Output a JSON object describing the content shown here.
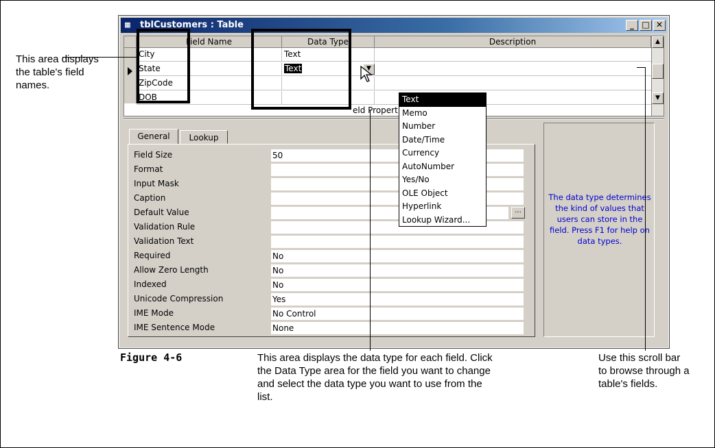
{
  "window": {
    "title": "tblCustomers : Table",
    "buttons": {
      "minimize": "_",
      "maximize": "□",
      "close": "✕"
    }
  },
  "grid": {
    "headers": [
      "Field Name",
      "Data Type",
      "Description"
    ],
    "rows": [
      {
        "field": "City",
        "type": "Text"
      },
      {
        "field": "State",
        "type": "Text"
      },
      {
        "field": "ZipCode",
        "type": ""
      },
      {
        "field": "DOB",
        "type": ""
      }
    ],
    "field_properties_label": "eld Properties"
  },
  "dropdown_items": [
    "Text",
    "Memo",
    "Number",
    "Date/Time",
    "Currency",
    "AutoNumber",
    "Yes/No",
    "OLE Object",
    "Hyperlink",
    "Lookup Wizard..."
  ],
  "tabs": [
    "General",
    "Lookup"
  ],
  "properties": [
    {
      "label": "Field Size",
      "value": "50"
    },
    {
      "label": "Format",
      "value": ""
    },
    {
      "label": "Input Mask",
      "value": ""
    },
    {
      "label": "Caption",
      "value": ""
    },
    {
      "label": "Default Value",
      "value": ""
    },
    {
      "label": "Validation Rule",
      "value": ""
    },
    {
      "label": "Validation Text",
      "value": ""
    },
    {
      "label": "Required",
      "value": "No"
    },
    {
      "label": "Allow Zero Length",
      "value": "No"
    },
    {
      "label": "Indexed",
      "value": "No"
    },
    {
      "label": "Unicode Compression",
      "value": "Yes"
    },
    {
      "label": "IME Mode",
      "value": "No Control"
    },
    {
      "label": "IME Sentence Mode",
      "value": "None"
    }
  ],
  "help_text": "The data type determines the kind of values that users can store in the field.  Press F1 for help on data types.",
  "annotations": {
    "left": "This area displays the table's field names.",
    "figure": "Figure 4-6",
    "bottom": "This area displays the data type for each field. Click the Data Type area for the field you want to change and select the data type you want to use from the list.",
    "right": "Use this scroll bar to browse through a table's fields."
  }
}
